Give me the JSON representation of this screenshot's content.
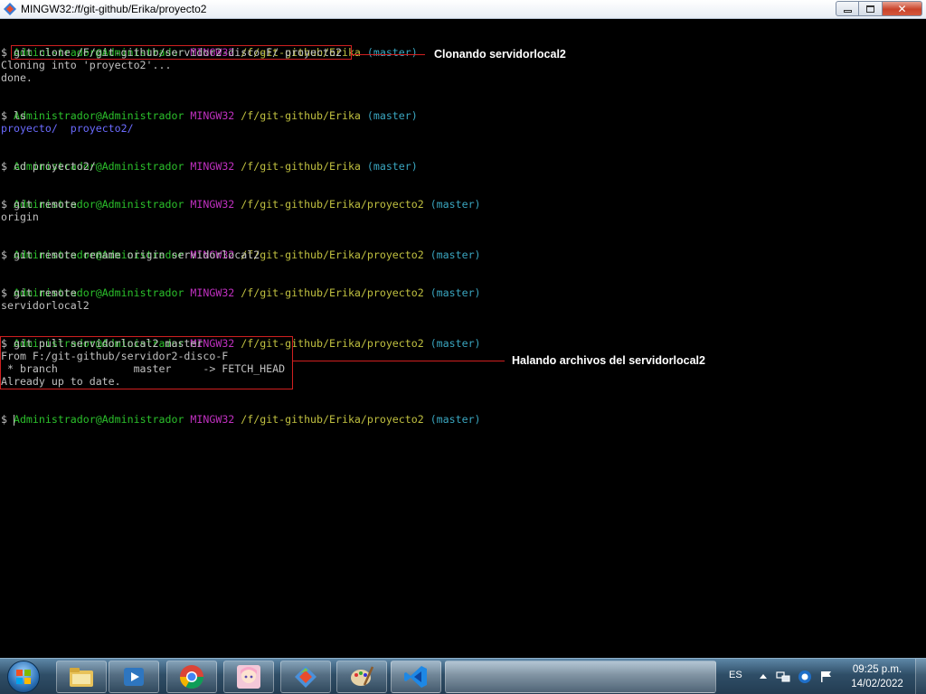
{
  "window": {
    "title": "MINGW32:/f/git-github/Erika/proyecto2",
    "minimize": "▭",
    "restore": "⧉",
    "close": "✕"
  },
  "terminal": {
    "prompt_user": "Administrador@Administrador",
    "prompt_env": "MINGW32",
    "lines": {
      "l1_path": "/f/git-github/Erika",
      "branch": "(master)",
      "cmd_clone": "$ git clone /F/git-github/servidor2-disco-F/ proyecto2",
      "out_cloning": "Cloning into 'proyecto2'...",
      "out_done": "done.",
      "cmd_ls": "$ ls",
      "ls_item1": "proyecto/",
      "ls_item2": "proyecto2/",
      "cmd_cd": "$ cd proyecto2/",
      "path2": "/f/git-github/Erika/proyecto2",
      "cmd_remote": "$ git remote",
      "out_origin": "origin",
      "cmd_rename": "$ git remote rename origin servidorlocal2",
      "cmd_remote2": "$ git remote",
      "out_servidor": "servidorlocal2",
      "cmd_pull": "$ git pull servidorlocal2 master",
      "out_from": "From F:/git-github/servidor2-disco-F",
      "out_branch": " * branch            master     -> FETCH_HEAD",
      "out_uptodate": "Already up to date.",
      "final_prompt": "$ "
    }
  },
  "annotations": {
    "clone": "Clonando servidorlocal2",
    "pull": "Halando archivos del servidorlocal2"
  },
  "taskbar": {
    "language": "ES",
    "time": "09:25 p.m.",
    "date": "14/02/2022"
  }
}
